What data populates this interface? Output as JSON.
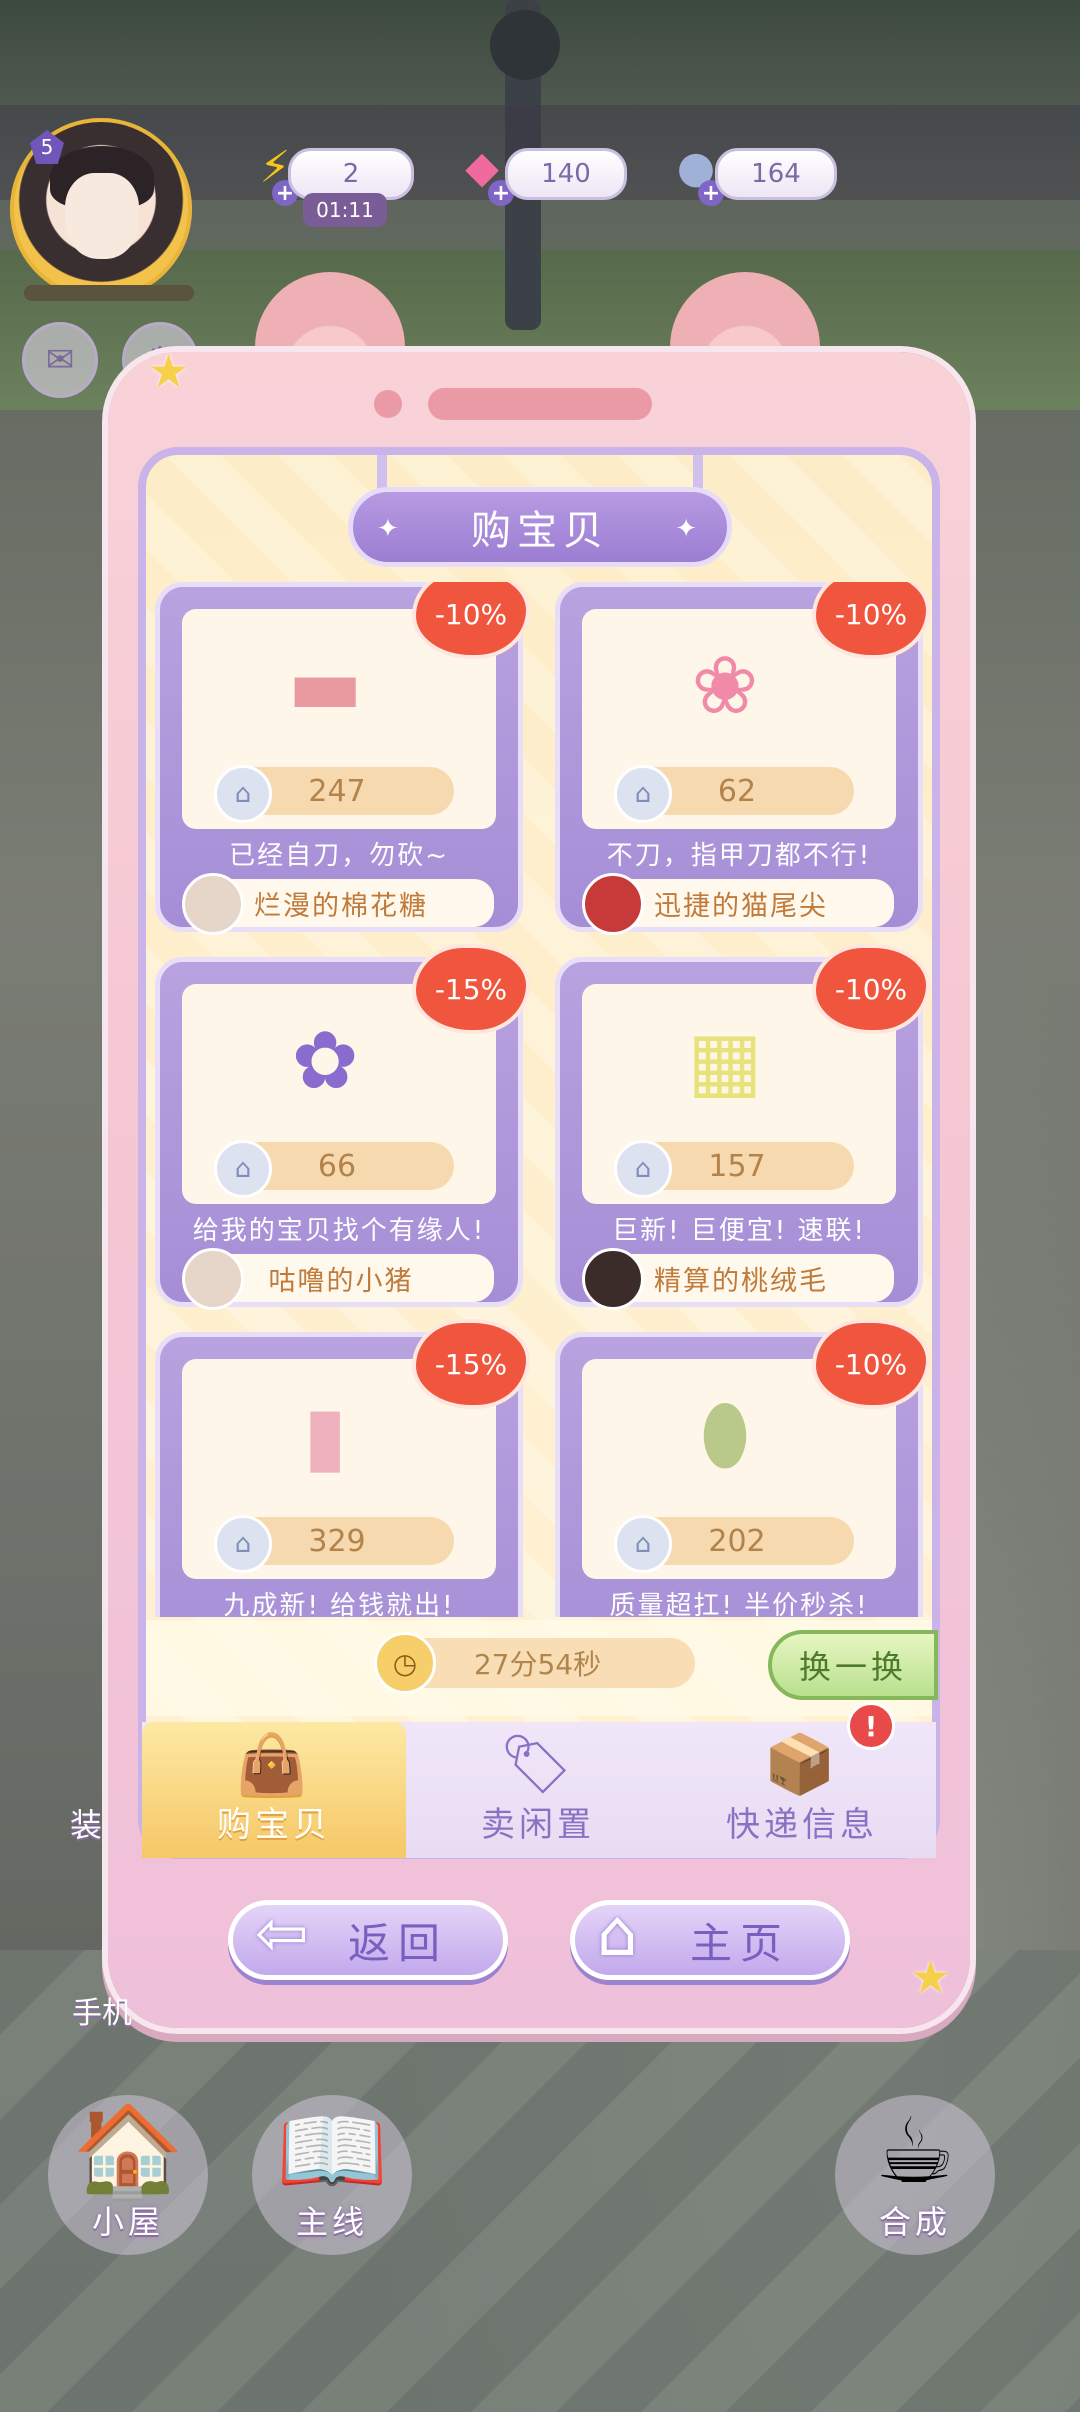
{
  "hud": {
    "level": "5",
    "energy": {
      "value": "2",
      "timer": "01:11",
      "icon": "lightning-icon"
    },
    "gems": {
      "value": "140",
      "icon": "gem-icon"
    },
    "coins": {
      "value": "164",
      "icon": "coin-icon"
    }
  },
  "panel": {
    "title": "购宝贝",
    "items": [
      {
        "discount": "-10%",
        "price": "247",
        "desc": "已经自刀，勿砍~",
        "seller": "烂漫的棉花糖",
        "icon": "bench-icon"
      },
      {
        "discount": "-10%",
        "price": "62",
        "desc": "不刀，指甲刀都不行!",
        "seller": "迅捷的猫尾尖",
        "icon": "flower-vase-icon"
      },
      {
        "discount": "-15%",
        "price": "66",
        "desc": "给我的宝贝找个有缘人!",
        "seller": "咕噜的小猪",
        "icon": "potted-hydrangea-icon"
      },
      {
        "discount": "-10%",
        "price": "157",
        "desc": "巨新! 巨便宜! 速联!",
        "seller": "精算的桃绒毛",
        "icon": "window-icon"
      },
      {
        "discount": "-15%",
        "price": "329",
        "desc": "九成新! 给钱就出!",
        "seller": "",
        "icon": "pink-scroll-icon"
      },
      {
        "discount": "-10%",
        "price": "202",
        "desc": "质量超扛! 半价秒杀!",
        "seller": "",
        "icon": "floral-plaque-icon"
      }
    ],
    "countdown": "27分54秒",
    "refresh_label": "换一换",
    "tabs": [
      {
        "label": "购宝贝",
        "icon": "shopping-bag-icon",
        "active": true
      },
      {
        "label": "卖闲置",
        "icon": "price-tag-icon",
        "active": false
      },
      {
        "label": "快递信息",
        "icon": "package-box-icon",
        "active": false
      }
    ],
    "alert_badge": "!"
  },
  "nav": {
    "back_label": "返回",
    "home_label": "主页"
  },
  "bottom_menu": [
    {
      "label": "小屋",
      "icon": "house-icon"
    },
    {
      "label": "主线",
      "icon": "storybook-icon"
    },
    {
      "label": "合成",
      "icon": "teacup-icon"
    }
  ],
  "side_partial_labels": [
    "装",
    "手机"
  ],
  "colors": {
    "discount_badge": "#f0563e",
    "card_frame": "#a58ed6",
    "phone_body": "#f6c8d3",
    "refresh_button": "#b9e08f"
  }
}
